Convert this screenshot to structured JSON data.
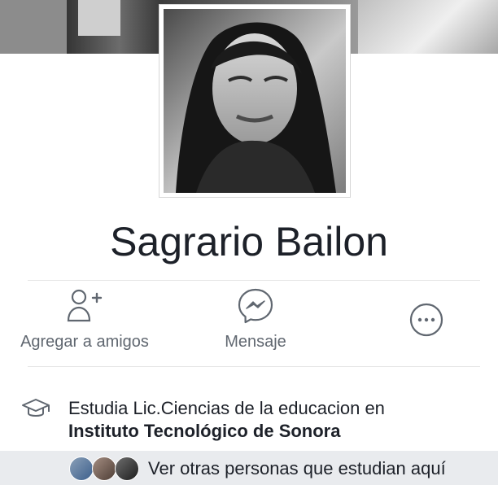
{
  "profile": {
    "name": "Sagrario Bailon",
    "photo_icon": "profile-photo",
    "cover_icon": "cover-photo"
  },
  "actions": [
    {
      "label": "Agregar a amigos",
      "icon": "add-friend-icon"
    },
    {
      "label": "Mensaje",
      "icon": "messenger-icon"
    },
    {
      "label": "",
      "icon": "more-options-icon"
    }
  ],
  "education": {
    "icon": "graduation-cap-icon",
    "prefix": "Estudia Lic.Ciencias de la educacion en",
    "institution": "Instituto Tecnológico de Sonora"
  },
  "classmates": {
    "text": "Ver otras personas que estudian aquí",
    "avatar_icons": [
      "classmate-avatar-1",
      "classmate-avatar-2",
      "classmate-avatar-3"
    ]
  },
  "colors": {
    "text_primary": "#1d2129",
    "text_secondary": "#606770",
    "bottom_bar": "#e9ebee",
    "icon_gray": "#606770"
  }
}
